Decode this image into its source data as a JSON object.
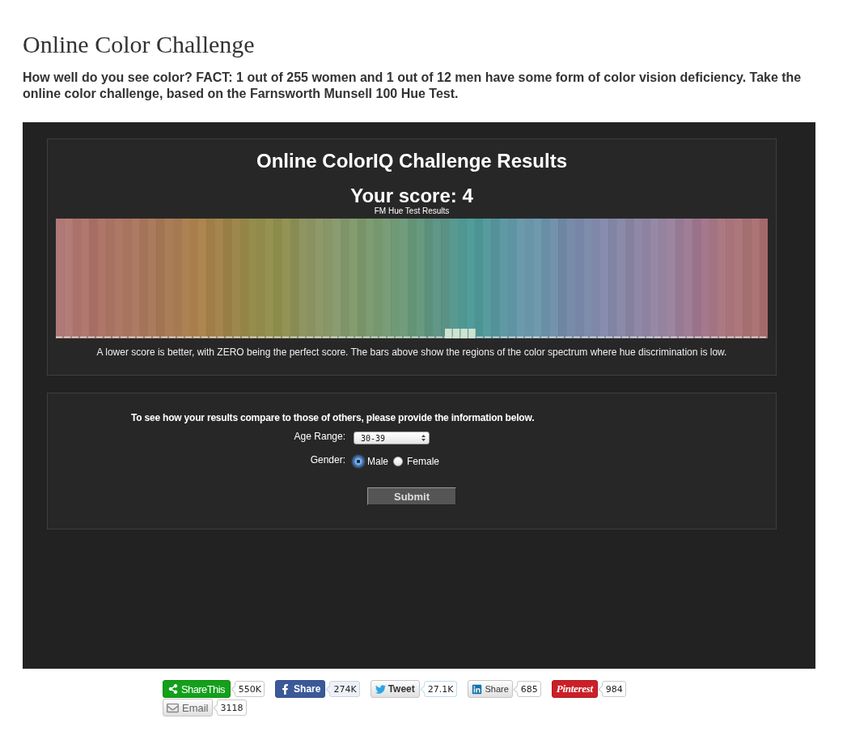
{
  "page": {
    "title": "Online Color Challenge",
    "intro": "How well do you see color? FACT: 1 out of 255 women and 1 out of 12 men have some form of color vision deficiency. Take the online color challenge, based on the Farnsworth Munsell 100 Hue Test."
  },
  "results": {
    "title": "Online ColorIQ Challenge Results",
    "score": "Your score: 4",
    "chart_caption": "FM Hue Test Results",
    "note": "A lower score is better, with ZERO being the perfect score. The bars above show the regions of the color spectrum where hue discrimination is low."
  },
  "form": {
    "prompt": "To see how your results compare to those of others, please provide the information below.",
    "age_range": {
      "label": "Age Range:",
      "value": "30-39"
    },
    "gender": {
      "label": "Gender:",
      "options": [
        {
          "label": "Male",
          "selected": true
        },
        {
          "label": "Female",
          "selected": false
        }
      ]
    },
    "submit": "Submit"
  },
  "share_buttons": [
    {
      "kind": "sharethis",
      "label": "ShareThis",
      "count": "550K"
    },
    {
      "kind": "facebook",
      "label": "Share",
      "count": "274K"
    },
    {
      "kind": "twitter",
      "label": "Tweet",
      "count": "27.1K"
    },
    {
      "kind": "linkedin",
      "label": "Share",
      "count": "685"
    },
    {
      "kind": "pinterest",
      "label": "Pinterest",
      "count": "984"
    },
    {
      "kind": "email",
      "label": "Email",
      "count": "3118"
    }
  ]
}
